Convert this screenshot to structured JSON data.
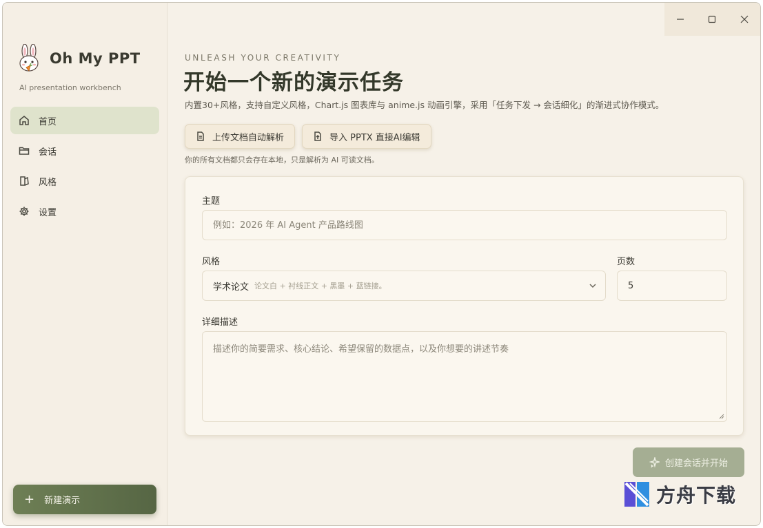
{
  "app": {
    "name": "Oh My PPT",
    "tagline": "AI presentation workbench"
  },
  "sidebar": {
    "items": [
      {
        "label": "首页",
        "icon": "home-icon",
        "active": true
      },
      {
        "label": "会话",
        "icon": "folder-icon",
        "active": false
      },
      {
        "label": "风格",
        "icon": "style-icon",
        "active": false
      },
      {
        "label": "设置",
        "icon": "gear-icon",
        "active": false
      }
    ],
    "new_button": "新建演示"
  },
  "main": {
    "eyebrow": "UNLEASH YOUR CREATIVITY",
    "title": "开始一个新的演示任务",
    "subtitle": "内置30+风格，支持自定义风格，Chart.js 图表库与 anime.js 动画引擎，采用「任务下发 → 会话细化」的渐进式协作模式。",
    "upload_button": "上传文档自动解析",
    "import_button": "导入 PPTX 直接AI编辑",
    "storage_note": "你的所有文档都只会存在本地，只是解析为 AI 可读文档。"
  },
  "form": {
    "topic_label": "主题",
    "topic_placeholder": "例如：2026 年 AI Agent 产品路线图",
    "style_label": "风格",
    "style_value": "学术论文",
    "style_hint": "论文白 + 衬线正文 + 黑墨 + 蓝链接。",
    "pages_label": "页数",
    "pages_value": "5",
    "desc_label": "详细描述",
    "desc_placeholder": "描述你的简要需求、核心结论、希望保留的数据点，以及你想要的讲述节奏"
  },
  "create_button": "创建会话并开始",
  "watermark": "方舟下载",
  "colors": {
    "background": "#f6f1e8",
    "accent": "#5f6f4b",
    "nav_active": "#dfe3cc",
    "create_disabled": "#a5ae93"
  }
}
